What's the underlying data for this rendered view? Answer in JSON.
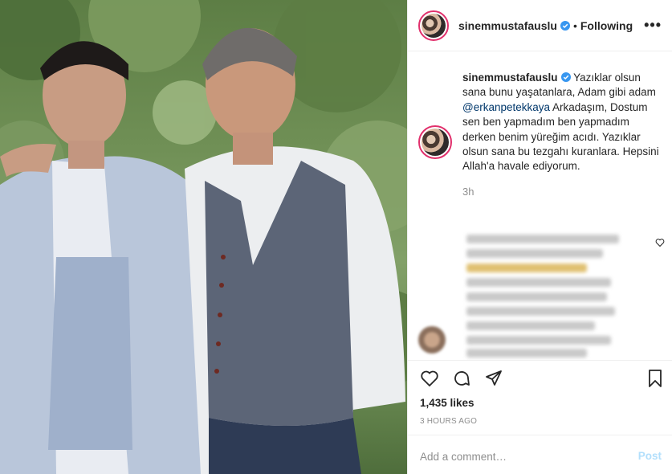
{
  "post": {
    "username": "sinemmustafauslu",
    "follow_status": "Following",
    "separator": "•",
    "more_label": "•••",
    "caption_username": "sinemmustafauslu",
    "caption_part1": "Yazıklar olsun sana bunu yaşatanlara, Adam gibi adam ",
    "caption_mention": "@erkanpetekkaya",
    "caption_part2": " Arkadaşım, Dostum sen ben yapmadım ben yapmadım derken benim yüreğim acıdı. Yazıklar olsun sana bu tezgahı kuranlara. Hepsini Allah'a havale ediyorum.",
    "relative_time": "3h",
    "likes": "1,435 likes",
    "timestamp": "3 HOURS AGO"
  },
  "comment_box": {
    "placeholder": "Add a comment…",
    "post_label": "Post"
  },
  "icons": {
    "verified": "verified-badge-icon",
    "like": "heart-icon",
    "comment": "comment-icon",
    "share": "share-icon",
    "save": "bookmark-icon",
    "comment_like": "small-heart-icon"
  },
  "colors": {
    "verified": "#3897f0",
    "mention": "#00376b",
    "post_button_disabled": "#b2dffc",
    "muted": "#8e8e8e"
  }
}
